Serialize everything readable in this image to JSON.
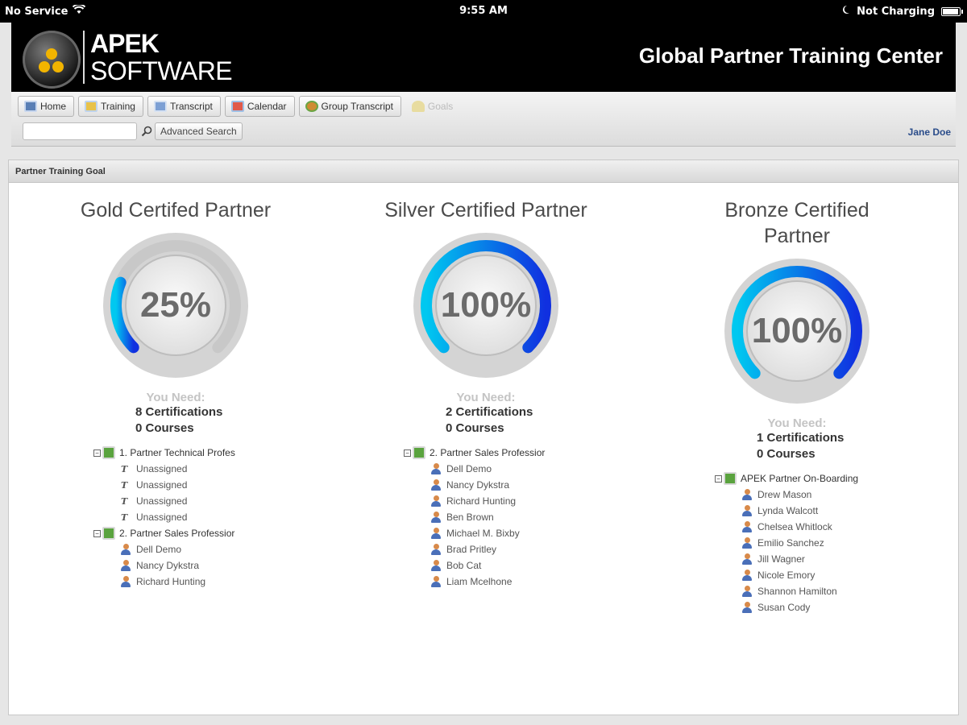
{
  "status_bar": {
    "carrier": "No Service",
    "time": "9:55 AM",
    "battery_text": "Not Charging"
  },
  "header": {
    "brand_top": "APEK",
    "brand_bottom": "SOFTWARE",
    "title": "Global Partner Training Center"
  },
  "toolbar": {
    "nav": [
      {
        "label": "Home",
        "icon": "home-icon"
      },
      {
        "label": "Training",
        "icon": "training-icon"
      },
      {
        "label": "Transcript",
        "icon": "transcript-icon"
      },
      {
        "label": "Calendar",
        "icon": "calendar-icon"
      },
      {
        "label": "Group Transcript",
        "icon": "group-transcript-icon"
      },
      {
        "label": "Goals",
        "icon": "goals-icon"
      }
    ],
    "search_value": "",
    "advanced_search_label": "Advanced Search",
    "user_name": "Jane Doe"
  },
  "panel": {
    "title": "Partner Training Goal",
    "you_need_label": "You Need:",
    "goals": [
      {
        "title": "Gold Certifed Partner",
        "percent": 25,
        "percent_label": "25%",
        "certifications": "8 Certifications",
        "courses": "0 Courses",
        "groups": [
          {
            "label": "1. Partner Technical Profes",
            "children": [
              "Unassigned",
              "Unassigned",
              "Unassigned",
              "Unassigned"
            ],
            "child_type": "unassigned"
          },
          {
            "label": "2. Partner Sales Professior",
            "children": [
              "Dell Demo",
              "Nancy Dykstra",
              "Richard Hunting"
            ],
            "child_type": "user"
          }
        ]
      },
      {
        "title": "Silver Certified Partner",
        "percent": 100,
        "percent_label": "100%",
        "certifications": "2 Certifications",
        "courses": "0 Courses",
        "groups": [
          {
            "label": "2. Partner Sales Professior",
            "children": [
              "Dell Demo",
              "Nancy Dykstra",
              "Richard Hunting",
              "Ben Brown",
              "Michael M. Bixby",
              "Brad Pritley",
              "Bob Cat",
              "Liam Mcelhone"
            ],
            "child_type": "user"
          }
        ]
      },
      {
        "title_line1": "Bronze Certified",
        "title_line2": "Partner",
        "percent": 100,
        "percent_label": "100%",
        "certifications": "1 Certifications",
        "courses": "0 Courses",
        "groups": [
          {
            "label": "APEK Partner On-Boarding",
            "children": [
              "Drew Mason",
              "Lynda Walcott",
              "Chelsea Whitlock",
              "Emilio Sanchez",
              "Jill Wagner",
              "Nicole Emory",
              "Shannon Hamilton",
              "Susan Cody"
            ],
            "child_type": "user"
          }
        ]
      }
    ]
  },
  "colors": {
    "gauge_start": "#00c8f0",
    "gauge_end": "#1030e0",
    "gauge_track": "#c8c8c8",
    "header_bg": "#000000",
    "user_link": "#2a4c8a"
  }
}
